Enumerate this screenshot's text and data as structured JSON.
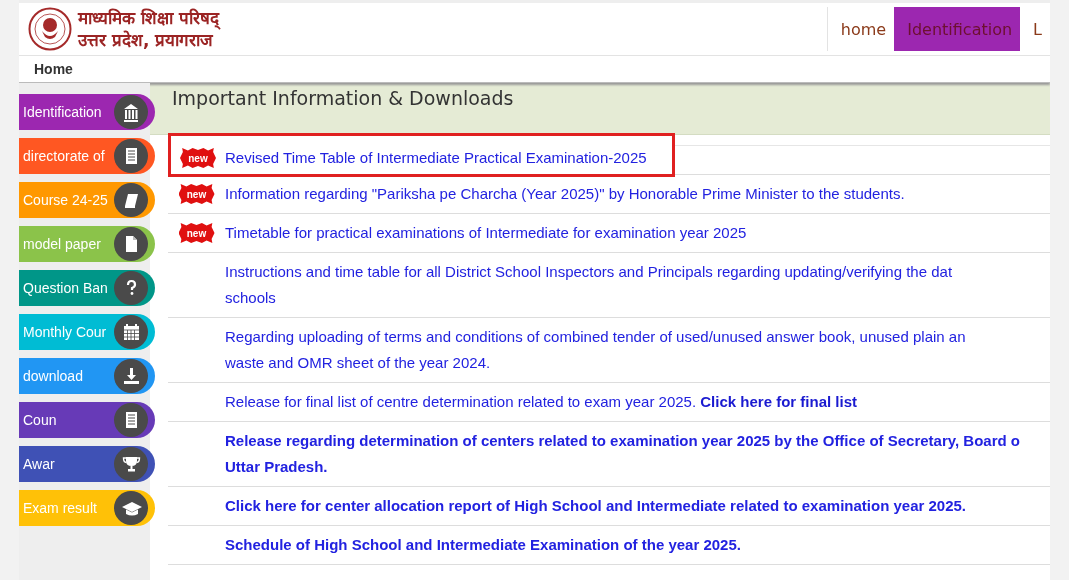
{
  "header": {
    "title_lines": [
      "माध्यमिक शिक्षा परिषद्",
      "उत्तर प्रदेश, प्रयागराज"
    ]
  },
  "nav": [
    {
      "label": "home",
      "selected": false
    },
    {
      "label": "Identification",
      "selected": true
    },
    {
      "label": "L",
      "selected": false
    }
  ],
  "breadcrumb": "Home",
  "sidebar": {
    "items": [
      {
        "label": "Identification",
        "color": "#9c27b0"
      },
      {
        "label": "directorate of",
        "color": "#ff5722"
      },
      {
        "label": "Course 24-25",
        "color": "#ff9800"
      },
      {
        "label": "model paper",
        "color": "#8bc34a"
      },
      {
        "label": "Question Ban",
        "color": "#009688"
      },
      {
        "label": "Monthly Cour",
        "color": "#00bcd4"
      },
      {
        "label": "download",
        "color": "#2196f3"
      },
      {
        "label": "Coun",
        "color": "#673ab7"
      },
      {
        "label": "Awar",
        "color": "#3f51b5"
      },
      {
        "label": "Exam result",
        "color": "#ffc107"
      }
    ]
  },
  "section": {
    "title": "Important Information & Downloads",
    "notices": [
      {
        "badge": "new",
        "highlighted": true,
        "bold": false,
        "lines": [
          "Revised Time Table of Intermediate Practical Examination-2025"
        ]
      },
      {
        "badge": "new",
        "highlighted": false,
        "bold": false,
        "lines": [
          "Information regarding \"Pariksha pe Charcha (Year 2025)\" by Honorable Prime Minister to the students."
        ]
      },
      {
        "badge": "new",
        "highlighted": false,
        "bold": false,
        "lines": [
          "Timetable for practical examinations of Intermediate for examination year 2025"
        ]
      },
      {
        "highlighted": false,
        "bold": false,
        "lines": [
          "Instructions and time table for all District School Inspectors and Principals regarding updating/verifying the dat",
          "schools"
        ]
      },
      {
        "highlighted": false,
        "bold": false,
        "lines": [
          "Regarding uploading of terms and conditions of combined tender of used/unused answer book, unused plain an",
          "waste and OMR sheet of the year 2024."
        ]
      },
      {
        "highlighted": false,
        "bold": false,
        "lines": [
          "Release for final list of centre determination related to exam year 2025."
        ],
        "link": "Click here for final list"
      },
      {
        "highlighted": false,
        "bold": true,
        "lines": [
          "Release regarding determination of centers related to examination year 2025 by the Office of Secretary, Board o",
          "Uttar Pradesh."
        ]
      },
      {
        "highlighted": false,
        "bold": true,
        "lines": [
          "Click here for center allocation report of High School and Intermediate related to examination year 2025."
        ]
      },
      {
        "highlighted": false,
        "bold": true,
        "lines": [
          "Schedule of High School and Intermediate Examination of the year 2025."
        ]
      }
    ]
  }
}
